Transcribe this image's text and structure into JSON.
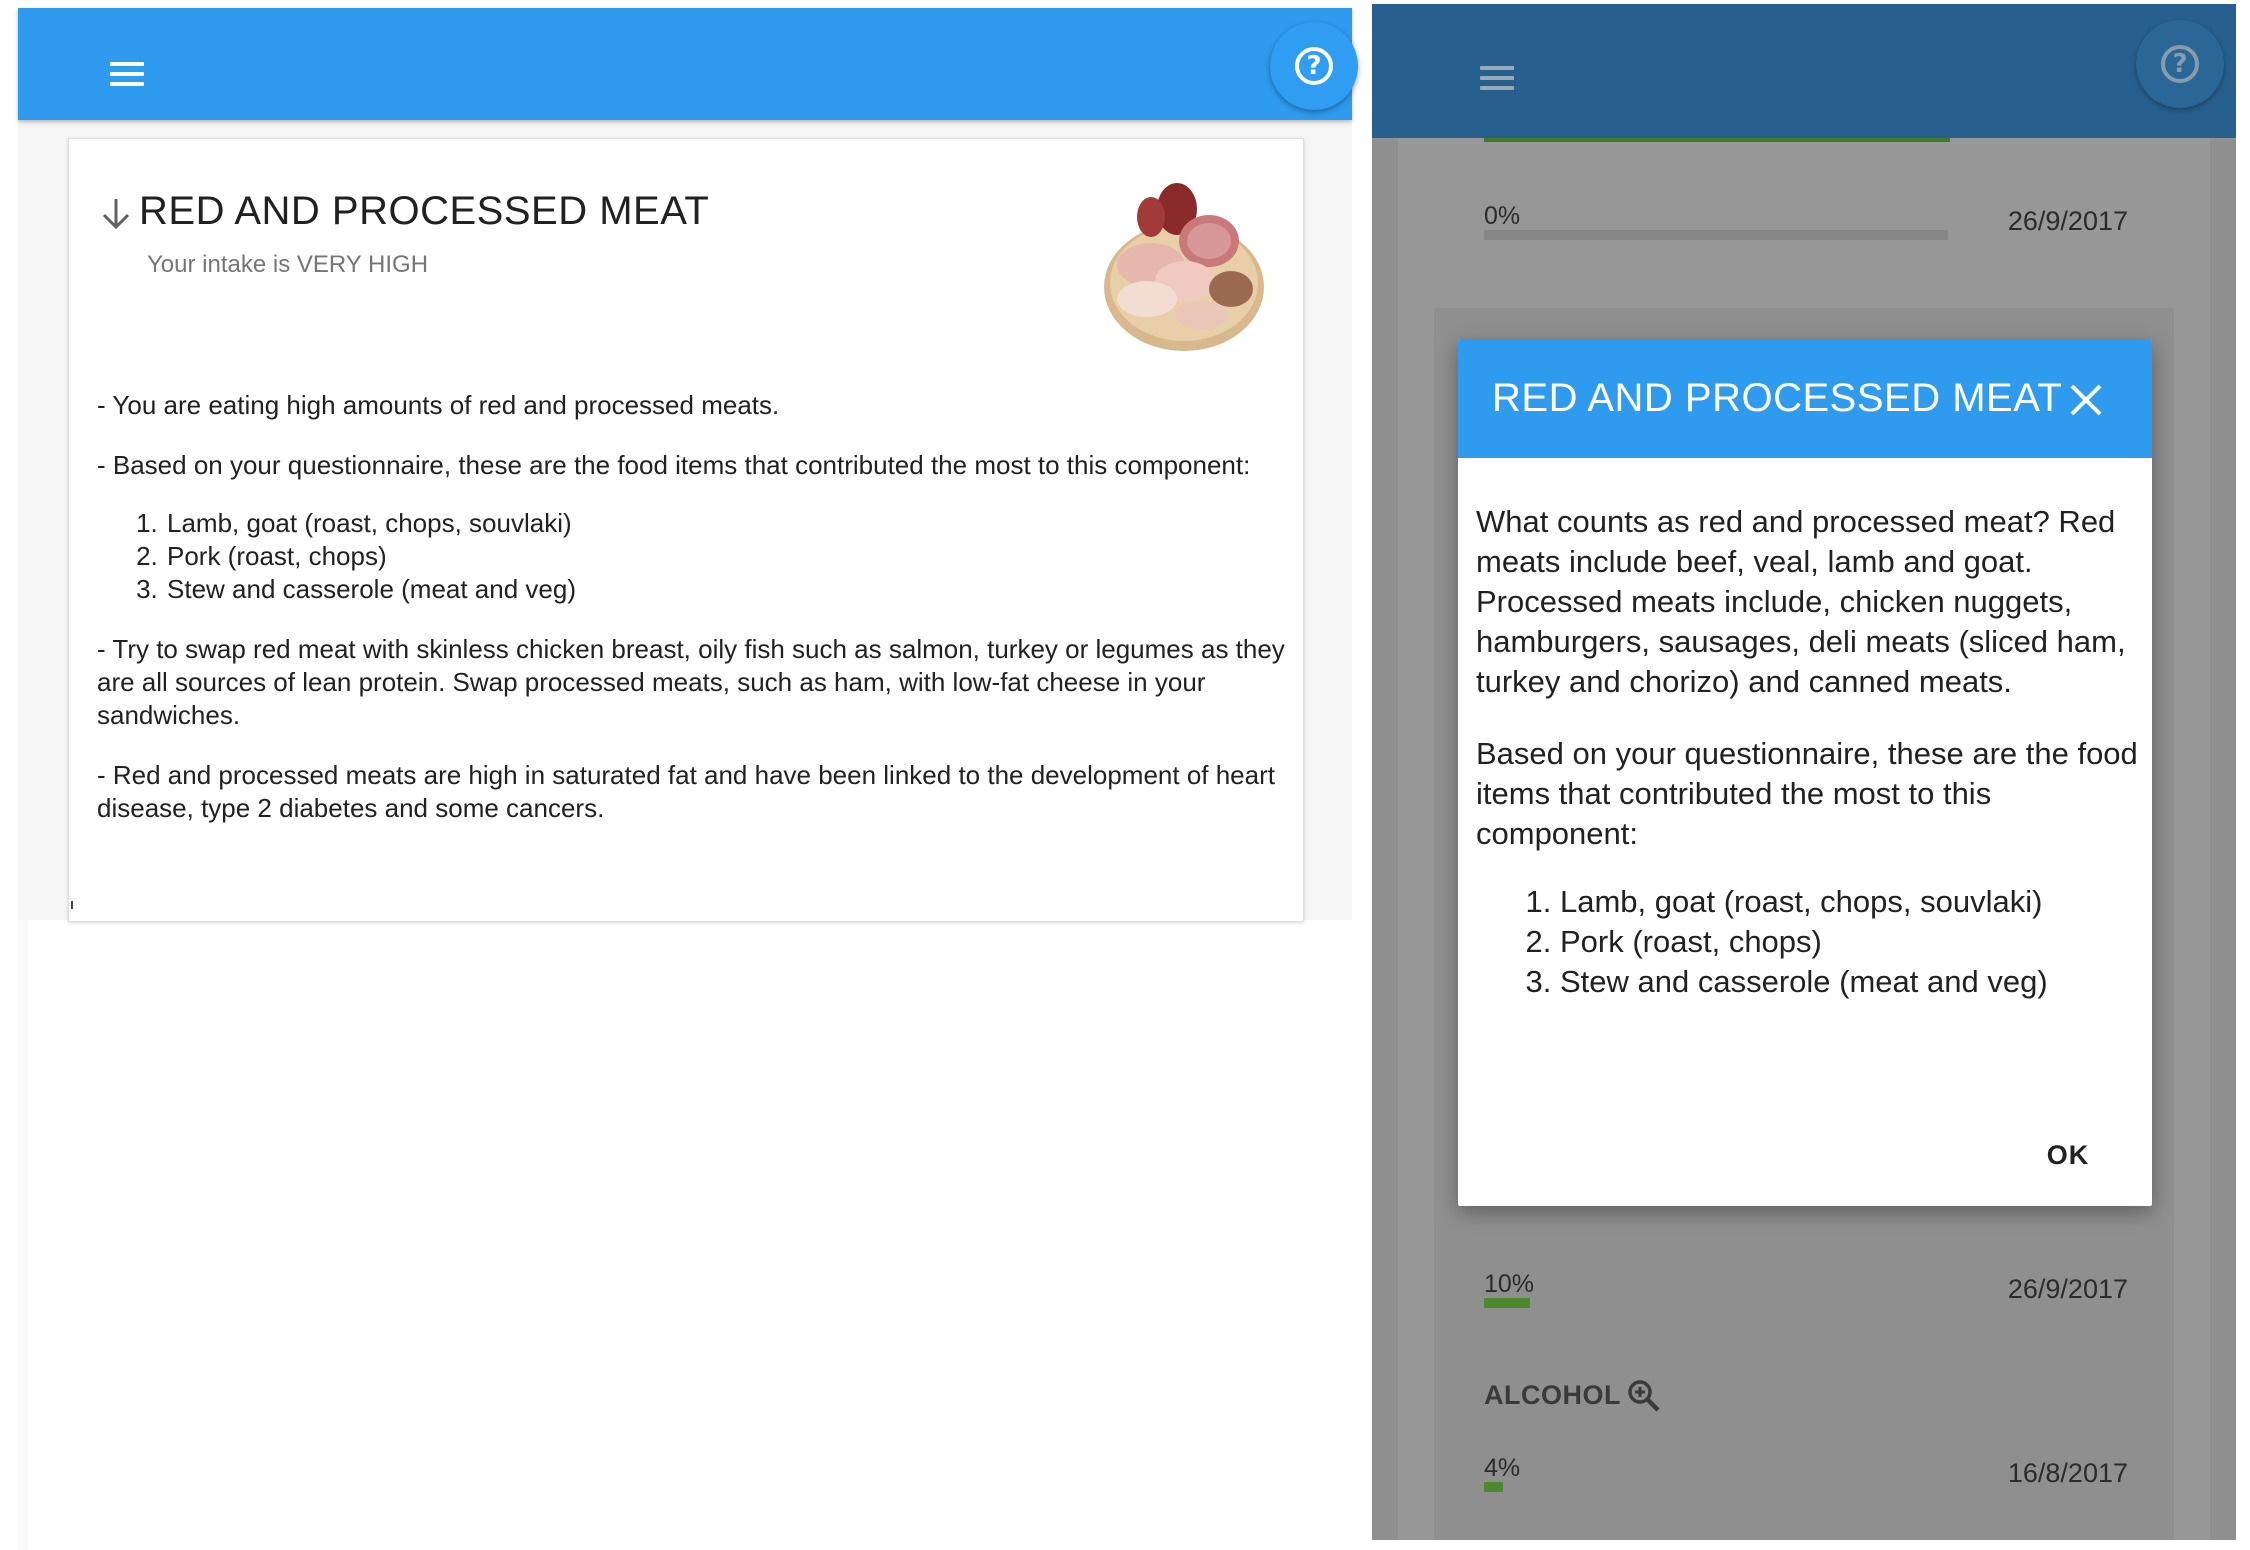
{
  "left_panel": {
    "card": {
      "title": "RED AND PROCESSED MEAT",
      "subtitle": "Your intake is VERY HIGH",
      "icons": {
        "arrow": "arrow-down-icon",
        "menu": "hamburger-menu-icon",
        "help": "help-circle-icon"
      },
      "paragraph_1": "- You are eating high amounts of red and processed meats.",
      "paragraph_2": "- Based on your questionnaire, these are the food items that contributed the most to this component:",
      "list": [
        "Lamb, goat (roast, chops, souvlaki)",
        "Pork (roast, chops)",
        "Stew and casserole (meat and veg)"
      ],
      "paragraph_3": "- Try to swap red meat with skinless chicken breast, oily fish such as salmon, turkey or legumes as they are all sources of lean protein. Swap processed meats, such as ham, with low-fat cheese in your sandwiches.",
      "paragraph_4": "- Red and processed meats are high in saturated fat and have been linked to the development of heart disease, type 2 diabetes and some cancers."
    }
  },
  "right_panel": {
    "rows": [
      {
        "percent": "0%",
        "date": "26/9/2017",
        "fill": 0
      },
      {
        "percent": "10%",
        "date": "26/9/2017",
        "fill": 0.1
      },
      {
        "percent": "4%",
        "date": "16/8/2017",
        "fill": 0.04
      }
    ],
    "alcohol_label": "ALCOHOL",
    "dialog": {
      "title": "RED AND PROCESSED MEAT",
      "paragraph_1": "What counts as red and processed meat? Red meats include beef, veal, lamb and goat. Processed meats include, chicken nuggets, hamburgers, sausages, deli meats (sliced ham, turkey and chorizo) and canned meats.",
      "paragraph_2": "Based on your questionnaire, these are the food items that contributed the most to this component:",
      "list": [
        "Lamb, goat (roast, chops, souvlaki)",
        "Pork (roast, chops)",
        "Stew and casserole (meat and veg)"
      ],
      "ok_label": "OK"
    }
  },
  "colors": {
    "app_bar": "#2e9bef",
    "app_bar_dimmed": "#27608f",
    "overlay": "#979797",
    "progress_green": "#4c8a2d"
  }
}
